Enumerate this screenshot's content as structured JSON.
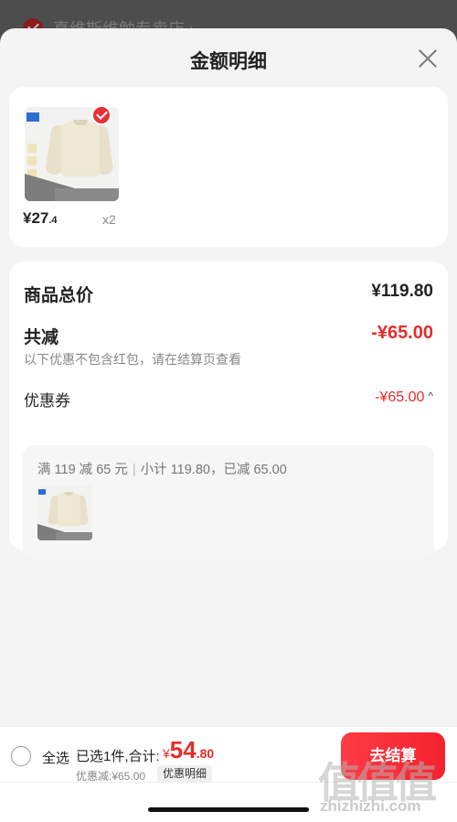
{
  "background": {
    "store_name": "真维斯维勉专卖店 ›"
  },
  "modal": {
    "title": "金额明细"
  },
  "product": {
    "price_main": "¥27",
    "price_decimal": ".4",
    "quantity": "x2"
  },
  "summary": {
    "total_label": "商品总价",
    "total_value": "¥119.80",
    "reduce_label": "共减",
    "reduce_value": "-¥65.00",
    "hint": "以下优惠不包含红包，请在结算页查看",
    "coupon_label": "优惠券",
    "coupon_value": "-¥65.00",
    "coupon_chevron": "^"
  },
  "coupon_detail": {
    "rule": "满 119 减 65 元",
    "separator": "|",
    "subtotal": "小计 119.80，已减 65.00"
  },
  "bottom_bar": {
    "select_all": "全选",
    "selected_info": "已选1件,合计:",
    "currency": "¥",
    "total_int": "54",
    "total_dec": ".80",
    "discount_line": "优惠减:¥65.00",
    "detail_button": "优惠明细",
    "checkout_button": "去结算"
  },
  "watermark": {
    "logo": "值值值",
    "text": "zhizhizhi.com"
  },
  "colors": {
    "accent": "#e62c2c",
    "checkout": "#f2232d"
  }
}
